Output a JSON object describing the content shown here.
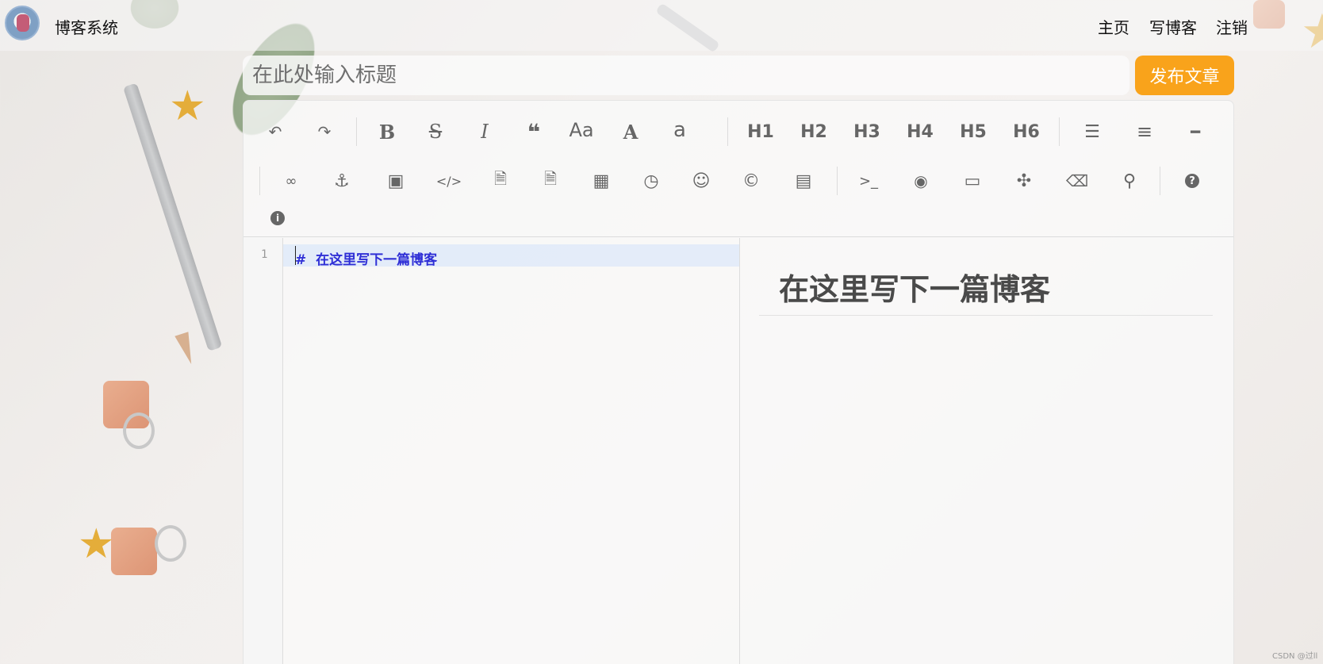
{
  "nav": {
    "site_title": "博客系统",
    "links": [
      "主页",
      "写博客",
      "注销"
    ]
  },
  "editor_header": {
    "title_placeholder": "在此处输入标题",
    "publish_label": "发布文章"
  },
  "toolbar": {
    "row1": [
      {
        "name": "undo-icon",
        "glyph": "↶"
      },
      {
        "name": "redo-icon",
        "glyph": "↷"
      },
      {
        "name": "bold-icon",
        "glyph": "B"
      },
      {
        "name": "strikethrough-icon",
        "glyph": "S̶"
      },
      {
        "name": "italic-icon",
        "glyph": "I"
      },
      {
        "name": "quote-icon",
        "glyph": "❝"
      },
      {
        "name": "uppercase-first-icon",
        "glyph": "Aa"
      },
      {
        "name": "uppercase-icon",
        "glyph": "A"
      },
      {
        "name": "lowercase-icon",
        "glyph": "a"
      },
      {
        "name": "h1-button",
        "glyph": "H1"
      },
      {
        "name": "h2-button",
        "glyph": "H2"
      },
      {
        "name": "h3-button",
        "glyph": "H3"
      },
      {
        "name": "h4-button",
        "glyph": "H4"
      },
      {
        "name": "h5-button",
        "glyph": "H5"
      },
      {
        "name": "h6-button",
        "glyph": "H6"
      },
      {
        "name": "unordered-list-icon",
        "glyph": "☰"
      },
      {
        "name": "ordered-list-icon",
        "glyph": "≡"
      },
      {
        "name": "horizontal-rule-icon",
        "glyph": "━"
      }
    ],
    "row2": [
      {
        "name": "link-icon",
        "glyph": "🔗"
      },
      {
        "name": "anchor-icon",
        "glyph": "⚓"
      },
      {
        "name": "image-icon",
        "glyph": "▣"
      },
      {
        "name": "inline-code-icon",
        "glyph": "</>"
      },
      {
        "name": "code-block-icon",
        "glyph": "⌘"
      },
      {
        "name": "preformatted-text-icon",
        "glyph": "⌘"
      },
      {
        "name": "table-icon",
        "glyph": "▦"
      },
      {
        "name": "datetime-icon",
        "glyph": "◷"
      },
      {
        "name": "emoji-icon",
        "glyph": "☺"
      },
      {
        "name": "html-entities-icon",
        "glyph": "©"
      },
      {
        "name": "pagebreak-icon",
        "glyph": "▤"
      },
      {
        "name": "goto-line-icon",
        "glyph": ">_"
      },
      {
        "name": "watch-toggle-icon",
        "glyph": "◉"
      },
      {
        "name": "preview-icon",
        "glyph": "▬"
      },
      {
        "name": "fullscreen-icon",
        "glyph": "✣"
      },
      {
        "name": "clear-icon",
        "glyph": "⌫"
      },
      {
        "name": "search-icon",
        "glyph": "⚲"
      },
      {
        "name": "help-icon",
        "glyph": "?"
      }
    ],
    "row3": [
      {
        "name": "info-icon",
        "glyph": "i"
      }
    ]
  },
  "editor": {
    "line_number": "1",
    "line_text": "#  在这里写下一篇博客",
    "preview_heading": "在这里写下一篇博客"
  },
  "watermark": "CSDN @过ll"
}
